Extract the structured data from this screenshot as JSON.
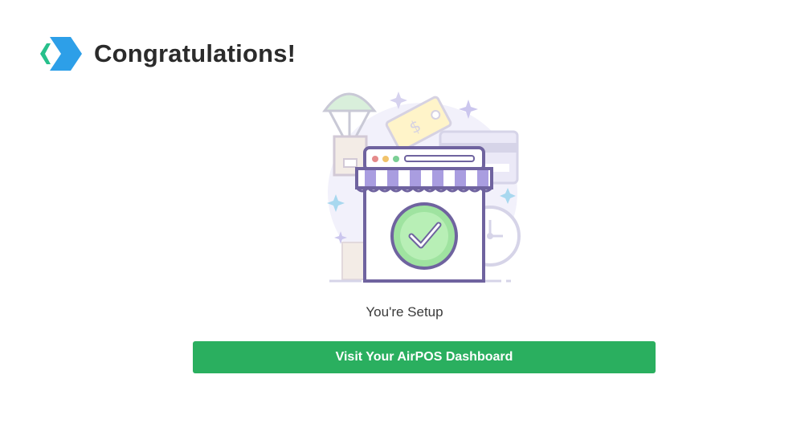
{
  "header": {
    "logo_icon": "airpos-logo-icon",
    "title": "Congratulations!"
  },
  "illustration": {
    "icon": "storefront-checkmark-illustration"
  },
  "status": {
    "text": "You're Setup"
  },
  "cta": {
    "label": "Visit Your AirPOS Dashboard"
  },
  "colors": {
    "accent_green": "#2aaf5f",
    "logo_blue": "#2d9fe8",
    "logo_teal": "#27c08b",
    "illustration_purple": "#7b6fb0"
  }
}
